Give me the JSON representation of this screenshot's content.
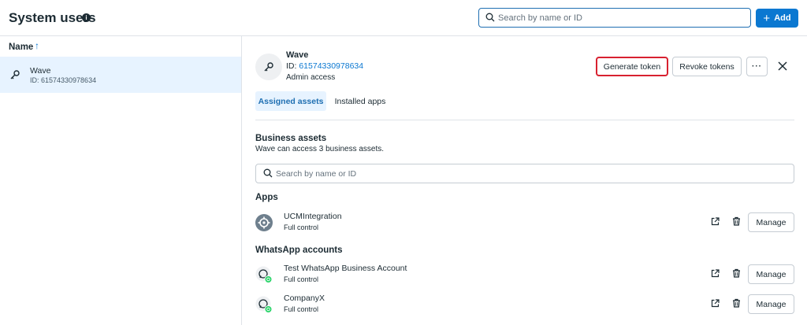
{
  "header": {
    "title": "System users",
    "info_icon": "info-icon",
    "search_placeholder": "Search by name or ID",
    "add_label": "Add"
  },
  "sidebar": {
    "column_header": "Name",
    "sort_icon": "arrow-up-icon",
    "items": [
      {
        "name": "Wave",
        "id": "ID: 61574330978634",
        "icon": "key-icon",
        "selected": true
      }
    ]
  },
  "detail": {
    "name": "Wave",
    "id_label": "ID: ",
    "id_value": "61574330978634",
    "access": "Admin access",
    "buttons": {
      "generate": "Generate token",
      "revoke": "Revoke tokens",
      "more": "···"
    },
    "tabs": [
      {
        "label": "Assigned assets",
        "active": true
      },
      {
        "label": "Installed apps",
        "active": false
      }
    ],
    "business_assets": {
      "title": "Business assets",
      "subtitle": "Wave can access 3 business assets.",
      "search_placeholder": "Search by name or ID"
    },
    "apps": {
      "title": "Apps",
      "items": [
        {
          "name": "UCMIntegration",
          "control": "Full control",
          "icon": "app-gear-icon",
          "action": "Manage"
        }
      ]
    },
    "whatsapp": {
      "title": "WhatsApp accounts",
      "items": [
        {
          "name": "Test WhatsApp Business Account",
          "control": "Full control",
          "icon": "whatsapp-icon",
          "action": "Manage"
        },
        {
          "name": "CompanyX",
          "control": "Full control",
          "icon": "whatsapp-icon",
          "action": "Manage"
        }
      ]
    }
  },
  "colors": {
    "primary": "#0b78d1",
    "selected_bg": "#e7f3ff",
    "highlight_border": "#d82130",
    "whatsapp_green": "#25d366"
  }
}
